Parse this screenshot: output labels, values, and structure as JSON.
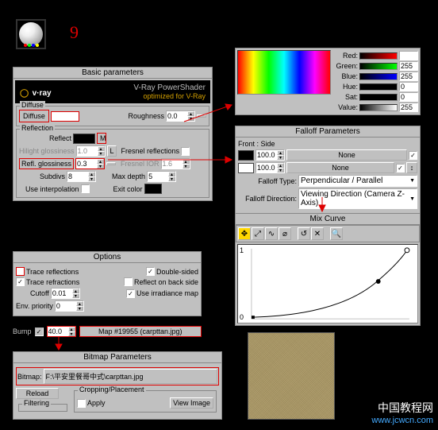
{
  "step_number": "9",
  "basic": {
    "title": "Basic parameters",
    "vray_brand": "v·ray",
    "vray_line1": "V-Ray PowerShader",
    "vray_line2": "optimized for V-Ray",
    "diffuse_group": "Diffuse",
    "diffuse_lbl": "Diffuse",
    "roughness_lbl": "Roughness",
    "roughness_val": "0.0",
    "reflection_group": "Reflection",
    "reflect_lbl": "Reflect",
    "m_btn": "M",
    "hgloss_lbl": "Hilight glossiness",
    "hgloss_val": "1.0",
    "l_btn": "L",
    "fresnel_lbl": "Fresnel reflections",
    "rgloss_lbl": "Refl. glossiness",
    "rgloss_val": "0.3",
    "fior_lbl": "Fresnel IOR",
    "fior_val": "1.6",
    "subdivs_lbl": "Subdivs",
    "subdivs_val": "8",
    "maxdepth_lbl": "Max depth",
    "maxdepth_val": "5",
    "interp_lbl": "Use interpolation",
    "exitcolor_lbl": "Exit color"
  },
  "colorpicker": {
    "red": "Red:",
    "green": "Green:",
    "blue": "Blue:",
    "hue": "Hue:",
    "sat": "Sat:",
    "value": "Value:",
    "red_v": "",
    "green_v": "255",
    "blue_v": "255",
    "hue_v": "0",
    "sat_v": "0",
    "value_v": "255"
  },
  "falloff": {
    "title": "Falloff Parameters",
    "frontside": "Front : Side",
    "v1": "100.0",
    "none1": "None",
    "v2": "100.0",
    "none2": "None",
    "type_lbl": "Falloff Type:",
    "type_val": "Perpendicular / Parallel",
    "dir_lbl": "Falloff Direction:",
    "dir_val": "Viewing Direction (Camera Z-Axis)"
  },
  "mixcurve": {
    "title": "Mix Curve",
    "y1": "1",
    "y0": "0"
  },
  "options": {
    "title": "Options",
    "trace_refl": "Trace reflections",
    "trace_refr": "Trace refractions",
    "double": "Double-sided",
    "reflback": "Reflect on back side",
    "useirr": "Use irradiance map",
    "cutoff_lbl": "Cutoff",
    "cutoff_val": "0.01",
    "envpri_lbl": "Env. priority",
    "envpri_val": "0"
  },
  "bump": {
    "label": "Bump",
    "val": "40.0",
    "map": "Map #19955 (carpttan.jpg)"
  },
  "bitmap": {
    "title": "Bitmap Parameters",
    "bitmap_lbl": "Bitmap:",
    "path": "F:\\平安里餐哥中式\\carpttan.jpg",
    "reload": "Reload",
    "crop_title": "Cropping/Placement",
    "apply": "Apply",
    "viewimg": "View Image",
    "filtering": "Filtering"
  },
  "watermark": {
    "cn": "中国教程网",
    "url": "www.jcwcn.com"
  }
}
